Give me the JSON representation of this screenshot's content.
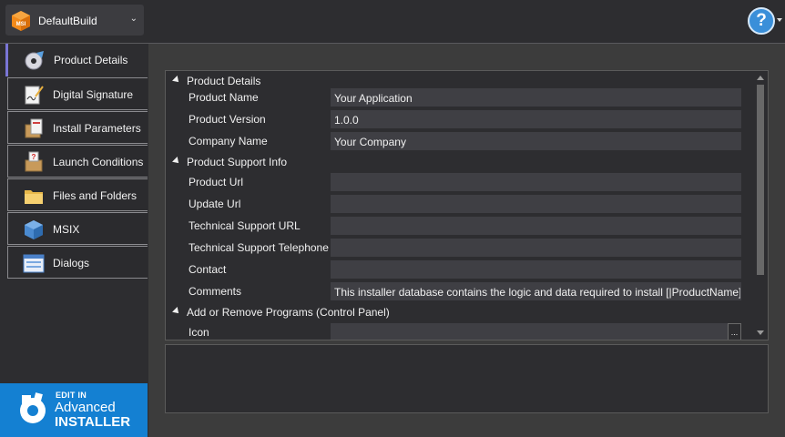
{
  "header": {
    "build_name": "DefaultBuild",
    "msi_icon_label": "MSI",
    "help_label": "?"
  },
  "sidebar": {
    "items": [
      {
        "label": "Product Details",
        "icon": "product-details-icon",
        "active": true
      },
      {
        "label": "Digital Signature",
        "icon": "digital-signature-icon",
        "active": false
      },
      {
        "label": "Install Parameters",
        "icon": "install-parameters-icon",
        "active": false
      },
      {
        "label": "Launch Conditions",
        "icon": "launch-conditions-icon",
        "active": false
      },
      {
        "label": "Files and Folders",
        "icon": "folder-icon",
        "active": false
      },
      {
        "label": "MSIX",
        "icon": "msix-icon",
        "active": false
      },
      {
        "label": "Dialogs",
        "icon": "dialogs-icon",
        "active": false
      }
    ],
    "ad": {
      "edit_in": "EDIT IN",
      "line1": "Advanced",
      "line2": "INSTALLER"
    }
  },
  "grid": {
    "sections": [
      {
        "title": "Product Details",
        "rows": [
          {
            "label": "Product Name",
            "value": "Your Application"
          },
          {
            "label": "Product Version",
            "value": "1.0.0"
          },
          {
            "label": "Company Name",
            "value": "Your Company"
          }
        ]
      },
      {
        "title": "Product Support Info",
        "rows": [
          {
            "label": "Product Url",
            "value": ""
          },
          {
            "label": "Update Url",
            "value": ""
          },
          {
            "label": "Technical Support URL",
            "value": ""
          },
          {
            "label": "Technical Support Telephone",
            "value": ""
          },
          {
            "label": "Contact",
            "value": ""
          },
          {
            "label": "Comments",
            "value": "This installer database contains the logic and data required to install [|ProductName]."
          }
        ]
      },
      {
        "title": "Add or Remove Programs (Control Panel)",
        "rows": [
          {
            "label": "Icon",
            "value": "",
            "browse_label": "..."
          }
        ]
      }
    ]
  },
  "colors": {
    "background": "#2d2d30",
    "accent": "#7a76d6",
    "ad_blue": "#1480d2",
    "help_blue": "#3a8fd9"
  }
}
